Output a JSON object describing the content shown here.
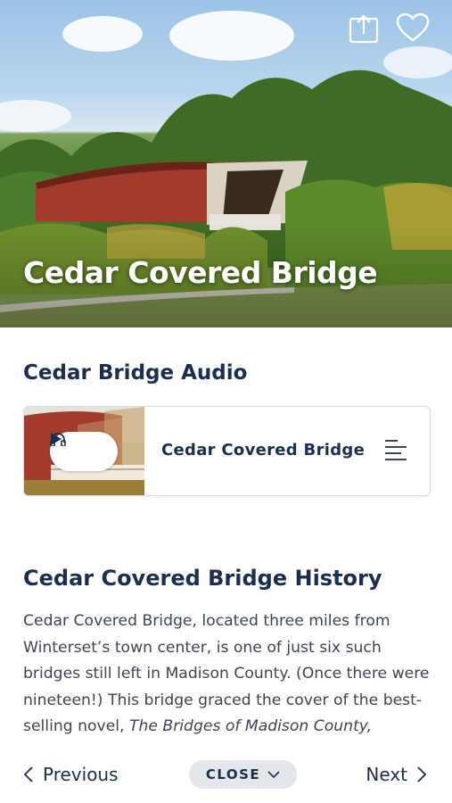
{
  "hero": {
    "title": "Cedar Covered Bridge",
    "share_icon": "share-icon",
    "favorite_icon": "heart-icon"
  },
  "audio": {
    "section_title": "Cedar Bridge Audio",
    "track_title": "Cedar Covered Bridge",
    "play_icons": [
      "headphones-icon",
      "play-icon"
    ],
    "list_icon": "list-icon"
  },
  "history": {
    "section_title": "Cedar Covered Bridge History",
    "text_before_italic": "Cedar Covered Bridge, located three miles from Winterset’s town center, is one of just six such bridges still left in Madison County. (Once there were nineteen!) This bridge graced the cover of the best-selling novel, ",
    "italic_title": "The Bridges of Madison County,"
  },
  "nav": {
    "previous_label": "Previous",
    "close_label": "CLOSE",
    "next_label": "Next"
  },
  "colors": {
    "navy": "#1b2e4b",
    "body_text": "#3c4653",
    "pill_bg": "#e3e6ea",
    "bridge_red": "#a33a2e"
  }
}
